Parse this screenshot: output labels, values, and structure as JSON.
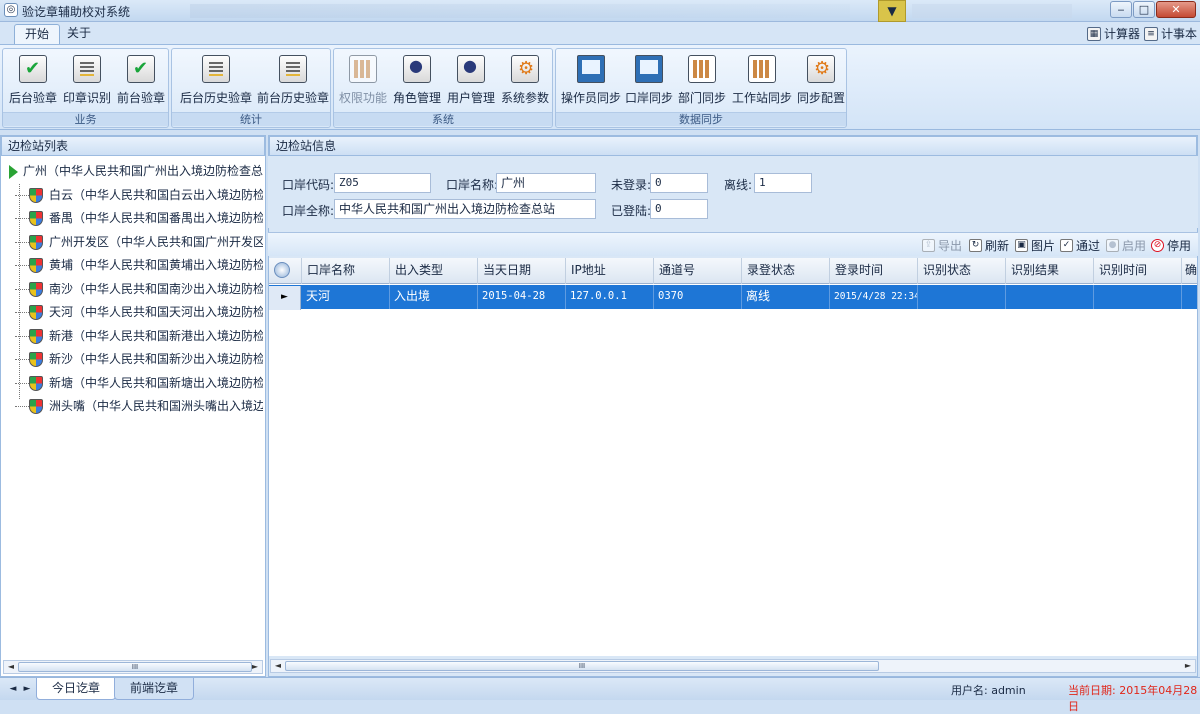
{
  "window": {
    "title": "验讫章辅助校对系统",
    "pin_glyph": "▼",
    "min": "‒",
    "max": "□",
    "close": "✕"
  },
  "menu": {
    "tabs": [
      "开始",
      "关于"
    ],
    "calculator": "计算器",
    "notepad": "计事本"
  },
  "ribbon": {
    "groups": [
      {
        "label": "业务",
        "buttons": [
          "后台验章",
          "印章识别",
          "前台验章"
        ]
      },
      {
        "label": "统计",
        "buttons": [
          "后台历史验章",
          "前台历史验章"
        ]
      },
      {
        "label": "系统",
        "buttons": [
          "权限功能",
          "角色管理",
          "用户管理",
          "系统参数"
        ]
      },
      {
        "label": "数据同步",
        "buttons": [
          "操作员同步",
          "口岸同步",
          "部门同步",
          "工作站同步",
          "同步配置"
        ]
      }
    ]
  },
  "left": {
    "header": "边检站列表",
    "root": "广州（中华人民共和国广州出入境边防检查总站）",
    "children": [
      "白云（中华人民共和国白云出入境边防检查站",
      "番禺（中华人民共和国番禺出入境边防检查站",
      "广州开发区（中华人民共和国广州开发区出入",
      "黄埔（中华人民共和国黄埔出入境边防检查站",
      "南沙（中华人民共和国南沙出入境边防检查站",
      "天河（中华人民共和国天河出入境边防检查站",
      "新港（中华人民共和国新港出入境边防检查站",
      "新沙（中华人民共和国新沙出入境边防检查站",
      "新塘（中华人民共和国新塘出入境边防检查站",
      "洲头嘴（中华人民共和国洲头嘴出入境边防检"
    ]
  },
  "info": {
    "header": "边检站信息",
    "code_label": "口岸代码:",
    "code_value": "Z05",
    "name_label": "口岸名称:",
    "name_value": "广州",
    "fullname_label": "口岸全称:",
    "fullname_value": "中华人民共和国广州出入境边防检查总站",
    "notlogged_label": "未登录:",
    "notlogged_value": "0",
    "loggedin_label": "已登陆:",
    "loggedin_value": "0",
    "offline_label": "离线:",
    "offline_value": "1"
  },
  "toolbar": {
    "export": "导出",
    "refresh": "刷新",
    "picture": "图片",
    "pass": "通过",
    "enable": "启用",
    "disable": "停用"
  },
  "grid": {
    "columns": [
      "口岸名称",
      "出入类型",
      "当天日期",
      "IP地址",
      "通道号",
      "录登状态",
      "登录时间",
      "识别状态",
      "识别结果",
      "识别时间",
      "确"
    ],
    "rows": [
      [
        "天河",
        "入出境",
        "2015-04-28",
        "127.0.0.1",
        "0370",
        "离线",
        "2015/4/28 22:34",
        "",
        "",
        ""
      ]
    ]
  },
  "scroll": {
    "thumb": "III"
  },
  "status": {
    "tabs": [
      "今日讫章",
      "前端讫章"
    ],
    "user": "用户名: admin",
    "date": "当前日期: 2015年04月28日",
    "date_color": "#e0261a"
  }
}
